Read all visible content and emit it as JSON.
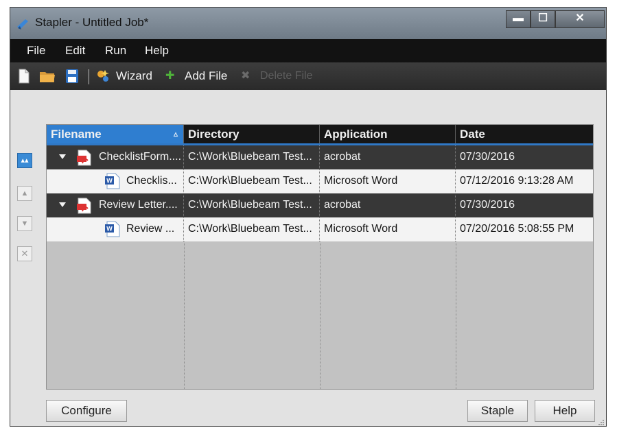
{
  "window": {
    "title": "Stapler - Untitled Job*",
    "min_glyph": "▬",
    "max_glyph": "☐",
    "close_glyph": "✕"
  },
  "menu": [
    "File",
    "Edit",
    "Run",
    "Help"
  ],
  "toolbar": {
    "wizard": "Wizard",
    "add_file": "Add File",
    "delete_file": "Delete File",
    "add_glyph": "✚",
    "delete_glyph": "✖"
  },
  "side_buttons": [
    {
      "glyph": "▴▴",
      "name": "move-to-top-button",
      "active": true
    },
    {
      "glyph": "▲",
      "name": "move-up-button",
      "active": false
    },
    {
      "glyph": "▼",
      "name": "move-down-button",
      "active": false
    },
    {
      "glyph": "✕",
      "name": "remove-button",
      "active": false
    }
  ],
  "grid": {
    "columns": [
      "Filename",
      "Directory",
      "Application",
      "Date"
    ],
    "sort_indicator": "▵",
    "rows": [
      {
        "type": "parent",
        "filename": "ChecklistForm....",
        "directory": "C:\\Work\\Bluebeam Test...",
        "application": "acrobat",
        "date": "07/30/2016"
      },
      {
        "type": "child",
        "filename": "Checklis...",
        "directory": "C:\\Work\\Bluebeam Test...",
        "application": "Microsoft Word",
        "date": "07/12/2016 9:13:28 AM"
      },
      {
        "type": "parent",
        "filename": "Review Letter....",
        "directory": "C:\\Work\\Bluebeam Test...",
        "application": "acrobat",
        "date": "07/30/2016"
      },
      {
        "type": "child",
        "filename": "Review ...",
        "directory": "C:\\Work\\Bluebeam Test...",
        "application": "Microsoft Word",
        "date": "07/20/2016 5:08:55 PM"
      }
    ]
  },
  "buttons": {
    "configure": "Configure",
    "staple": "Staple",
    "help": "Help"
  },
  "colors": {
    "accent": "#2f7ed0",
    "menubar": "#121212",
    "parent_row": "#373737",
    "child_row": "#f3f3f3"
  }
}
